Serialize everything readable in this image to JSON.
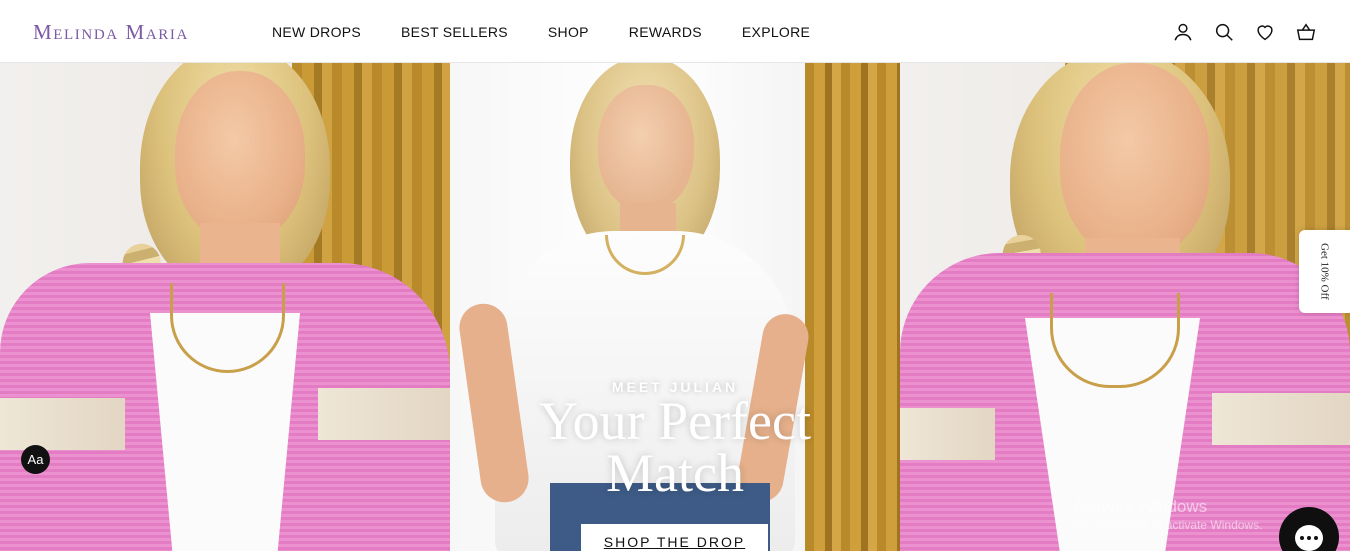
{
  "brand": {
    "logo_text": "Melinda Maria",
    "color": "#7d5aa6"
  },
  "nav": {
    "items": [
      {
        "label": "NEW DROPS"
      },
      {
        "label": "BEST SELLERS"
      },
      {
        "label": "SHOP"
      },
      {
        "label": "REWARDS"
      },
      {
        "label": "EXPLORE"
      }
    ]
  },
  "header_icons": [
    "account-icon",
    "search-icon",
    "wishlist-heart-icon",
    "cart-basket-icon"
  ],
  "hero": {
    "eyebrow": "MEET JULIAN",
    "headline_line1": "Your Perfect",
    "headline_line2": "Match",
    "cta_label": "SHOP THE DROP"
  },
  "side_tab": {
    "label": "Get 10% Off"
  },
  "accessibility_button": {
    "label": "Aa"
  },
  "windows_watermark": {
    "line1": "Activate Windows",
    "line2": "Go to Settings to activate Windows."
  }
}
